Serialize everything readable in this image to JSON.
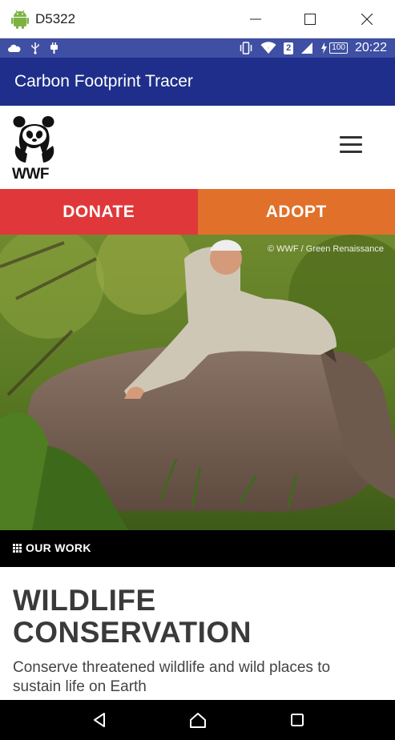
{
  "window": {
    "title": "D5322"
  },
  "status_bar": {
    "time": "20:22",
    "sim": "2",
    "battery": "100"
  },
  "app_bar": {
    "title": "Carbon Footprint Tracer"
  },
  "site": {
    "logo_text": "WWF"
  },
  "cta": {
    "donate": "DONATE",
    "adopt": "ADOPT"
  },
  "hero": {
    "credit": "© WWF / Green Renaissance"
  },
  "section": {
    "label": "OUR WORK"
  },
  "article": {
    "title_line1": "WILDLIFE",
    "title_line2": "CONSERVATION",
    "description": "Conserve threatened wildlife and wild places to sustain life on Earth"
  },
  "icons": [
    "android-icon",
    "minimize-icon",
    "maximize-icon",
    "close-icon",
    "cloud-icon",
    "usb-icon",
    "plug-icon",
    "vibrate-icon",
    "wifi-icon",
    "signal-icon",
    "battery-icon",
    "panda-logo-icon",
    "hamburger-menu-icon",
    "grid-icon",
    "back-icon",
    "home-icon",
    "recents-icon"
  ],
  "colors": {
    "app_bar": "#1e2e8a",
    "status_bar": "#3f4fa3",
    "donate": "#e0383a",
    "adopt": "#e0702a"
  }
}
